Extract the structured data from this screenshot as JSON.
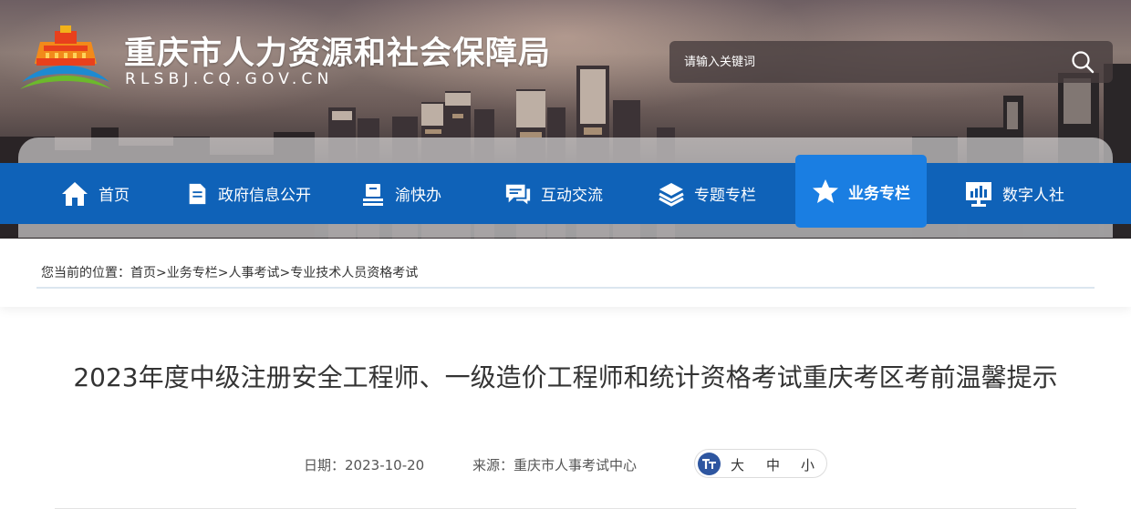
{
  "header": {
    "site_title": "重庆市人力资源和社会保障局",
    "site_domain": "RLSBJ.CQ.GOV.CN",
    "search": {
      "placeholder": "请输入关键词"
    }
  },
  "nav": {
    "items": [
      {
        "label": "首页",
        "icon": "home-icon"
      },
      {
        "label": "政府信息公开",
        "icon": "document-icon"
      },
      {
        "label": "渝快办",
        "icon": "book-stack-icon"
      },
      {
        "label": "互动交流",
        "icon": "chat-icon"
      },
      {
        "label": "专题专栏",
        "icon": "layers-icon"
      },
      {
        "label": "业务专栏",
        "icon": "star-icon",
        "active": true
      },
      {
        "label": "数字人社",
        "icon": "monitor-chart-icon"
      }
    ]
  },
  "breadcrumb": {
    "prefix": "您当前的位置：",
    "items": [
      "首页",
      "业务专栏",
      "人事考试",
      "专业技术人员资格考试"
    ],
    "separator": ">"
  },
  "article": {
    "title": "2023年度中级注册安全工程师、一级造价工程师和统计资格考试重庆考区考前温馨提示",
    "date_label": "日期：",
    "date": "2023-10-20",
    "source_label": "来源：",
    "source": "重庆市人事考试中心",
    "font_sizes": [
      "大",
      "中",
      "小"
    ]
  },
  "colors": {
    "nav_bg": "#0f62b8",
    "nav_active": "#1a7ee2",
    "text": "#333333",
    "font_icon": "#2e56a0"
  }
}
